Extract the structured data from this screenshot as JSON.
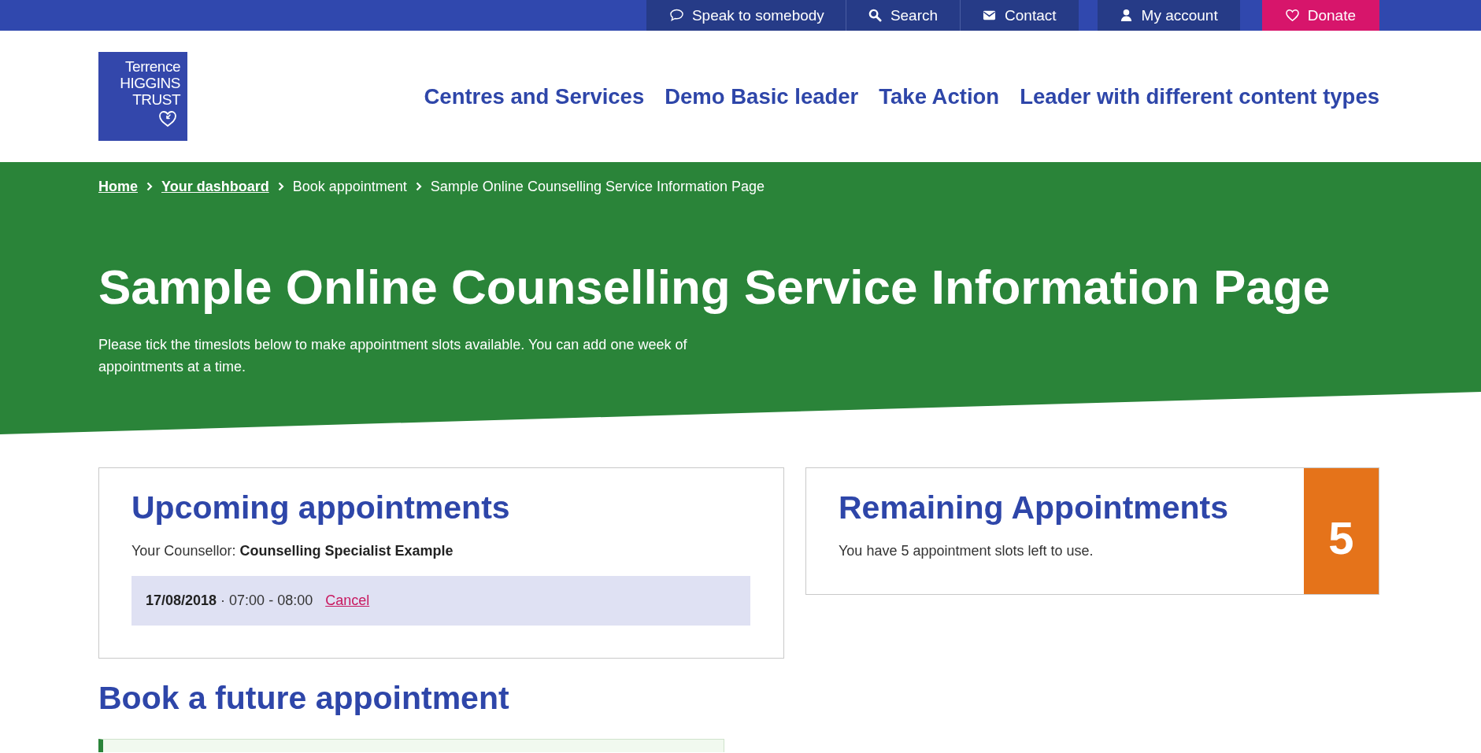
{
  "utility_bar": {
    "items": [
      {
        "kind": "speak",
        "label": "Speak to somebody"
      },
      {
        "kind": "search",
        "label": "Search"
      },
      {
        "kind": "contact",
        "label": "Contact"
      },
      {
        "kind": "account",
        "label": "My account"
      },
      {
        "kind": "donate",
        "label": "Donate"
      }
    ]
  },
  "logo": {
    "lines": [
      "Terrence",
      "HIGGINS",
      "TRUST"
    ]
  },
  "main_nav": {
    "items": [
      "Centres and Services",
      "Demo Basic leader",
      "Take Action",
      "Leader with different content types"
    ]
  },
  "breadcrumb": [
    {
      "label": "Home",
      "kind": "link"
    },
    {
      "label": "Your dashboard",
      "kind": "link"
    },
    {
      "label": "Book appointment",
      "kind": "text"
    },
    {
      "label": "Sample Online Counselling Service Information Page",
      "kind": "text"
    }
  ],
  "hero": {
    "title": "Sample Online Counselling Service Information Page",
    "intro": "Please tick the timeslots below to make appointment slots available. You can add one week of appointments at a time."
  },
  "upcoming": {
    "title": "Upcoming appointments",
    "counsellor": "Your Counsellor: **Counselling Specialist Example**",
    "appointments": [
      {
        "when": "**17/08/2018** · 07:00 - 08:00",
        "action": "Cancel"
      }
    ]
  },
  "remaining": {
    "title": "Remaining Appointments",
    "text": "You have 5 appointment slots left to use.",
    "count": "5"
  },
  "booking": {
    "title": "Book a future appointment"
  }
}
